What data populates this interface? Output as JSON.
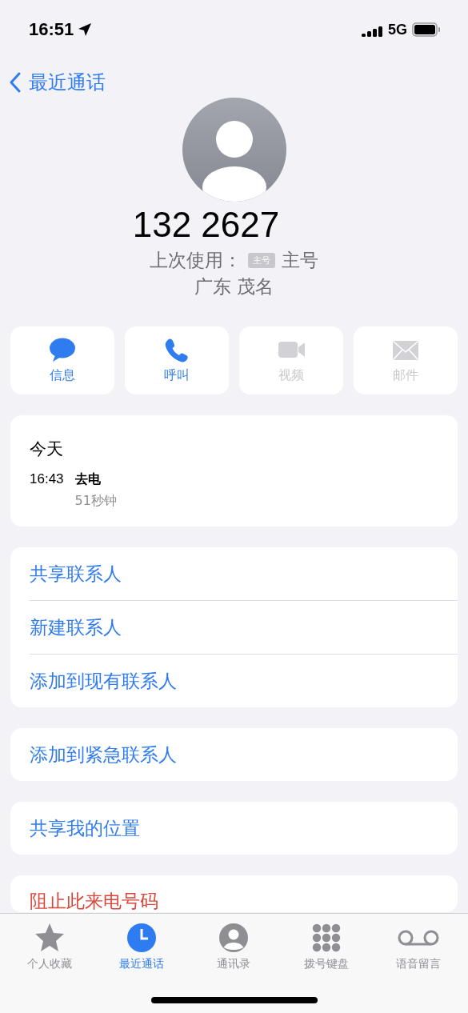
{
  "status_bar": {
    "time": "16:51",
    "network": "5G"
  },
  "nav": {
    "back_label": "最近通话"
  },
  "contact": {
    "number": "132 2627",
    "last_used_label": "上次使用：",
    "sim_badge": "主号",
    "sim_name": "主号",
    "location": "广东 茂名"
  },
  "actions": [
    {
      "kind": "message",
      "label": "信息",
      "disabled": false
    },
    {
      "kind": "call",
      "label": "呼叫",
      "disabled": false
    },
    {
      "kind": "video",
      "label": "视频",
      "disabled": true
    },
    {
      "kind": "mail",
      "label": "邮件",
      "disabled": true
    }
  ],
  "recents": {
    "day": "今天",
    "calls": [
      {
        "time": "16:43",
        "type": "去电",
        "duration": "51秒钟"
      }
    ]
  },
  "option_groups": [
    [
      {
        "label": "共享联系人",
        "destructive": false
      },
      {
        "label": "新建联系人",
        "destructive": false
      },
      {
        "label": "添加到现有联系人",
        "destructive": false
      }
    ],
    [
      {
        "label": "添加到紧急联系人",
        "destructive": false
      }
    ],
    [
      {
        "label": "共享我的位置",
        "destructive": false
      }
    ],
    [
      {
        "label": "阻止此来电号码",
        "destructive": true
      }
    ]
  ],
  "tab_bar": [
    {
      "kind": "star",
      "label": "个人收藏",
      "selected": false
    },
    {
      "kind": "clock",
      "label": "最近通话",
      "selected": true
    },
    {
      "kind": "person",
      "label": "通讯录",
      "selected": false
    },
    {
      "kind": "keypad",
      "label": "拨号键盘",
      "selected": false
    },
    {
      "kind": "voicemail",
      "label": "语音留言",
      "selected": false
    }
  ]
}
